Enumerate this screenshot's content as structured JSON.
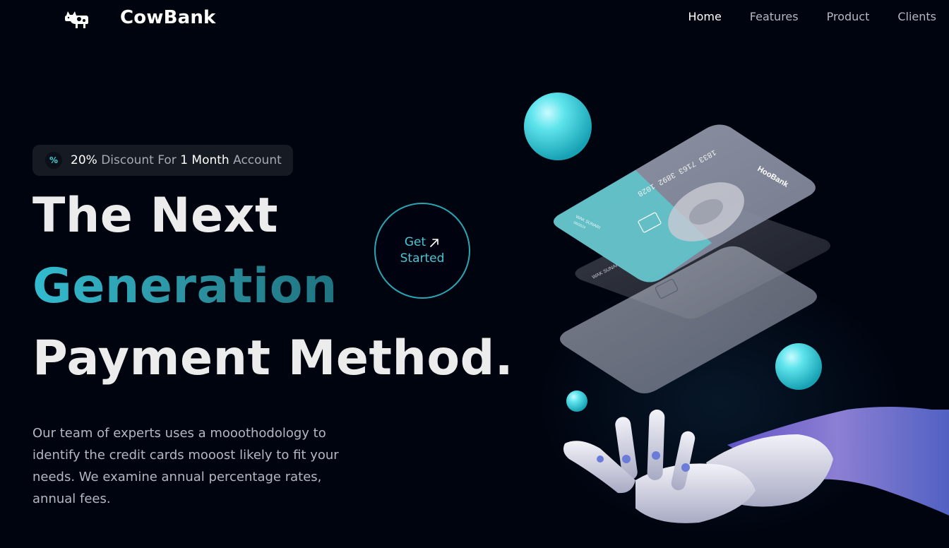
{
  "brand": {
    "name": "CowBank",
    "logo_icon": "cow-icon"
  },
  "nav": {
    "items": [
      {
        "label": "Home",
        "active": true
      },
      {
        "label": "Features",
        "active": false
      },
      {
        "label": "Product",
        "active": false
      },
      {
        "label": "Clients",
        "active": false
      }
    ]
  },
  "badge": {
    "icon": "discount-icon",
    "icon_glyph": "%",
    "percent": "20%",
    "text_a": " Discount For ",
    "months": "1 Month",
    "text_b": " Account"
  },
  "hero": {
    "line1": "The Next",
    "line2": "Generation",
    "line3": "Payment Method."
  },
  "cta": {
    "line1": "Get",
    "line2": "Started",
    "icon": "arrow-up-right-icon"
  },
  "description": "Our team of experts uses a mooothodology to identify the credit cards mooost likely to fit your needs. We examine annual percentage rates, annual fees.",
  "illustration": {
    "card_number": "1833 7163 3892 1028",
    "card_brand": "HooBank",
    "card_holder": "WAK SUNARI",
    "card_expiry": "06/2024"
  },
  "colors": {
    "background": "#00040f",
    "accent": "#33bbcf",
    "text_secondary": "#b4b8c2"
  }
}
